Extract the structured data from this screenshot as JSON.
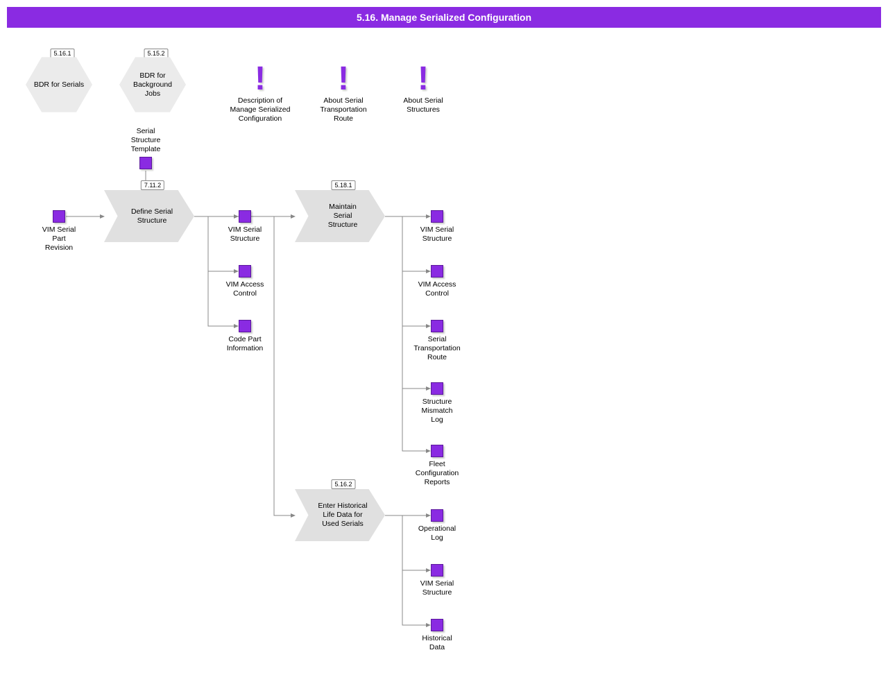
{
  "title": "5.16. Manage Serialized Configuration",
  "hexagons": {
    "bdr_serials": {
      "code": "5.16.1",
      "label": "BDR for Serials"
    },
    "bdr_background": {
      "code": "5.15.2",
      "label": "BDR for\nBackground\nJobs"
    }
  },
  "infos": {
    "desc": "Description of\nManage Serialized\nConfiguration",
    "route": "About Serial\nTransportation\nRoute",
    "structs": "About Serial\nStructures"
  },
  "processes": {
    "define": {
      "code": "7.11.2",
      "label": "Define Serial\nStructure"
    },
    "maintain": {
      "code": "5.18.1",
      "label": "Maintain\nSerial\nStructure"
    },
    "enter": {
      "code": "5.16.2",
      "label": "Enter Historical\nLife Data for\nUsed Serials"
    }
  },
  "data_nodes": {
    "serial_template": "Serial\nStructure\nTemplate",
    "vim_part_rev": "VIM Serial\nPart\nRevision",
    "vim_serial_struct1": "VIM Serial\nStructure",
    "vim_access1": "VIM Access\nControl",
    "code_part": "Code Part\nInformation",
    "vim_serial_struct2": "VIM Serial\nStructure",
    "vim_access2": "VIM Access\nControl",
    "serial_trans_route": "Serial\nTransportation\nRoute",
    "struct_mismatch": "Structure\nMismatch\nLog",
    "fleet_conf": "Fleet\nConfiguration\nReports",
    "op_log": "Operational\nLog",
    "vim_serial_struct3": "VIM Serial\nStructure",
    "hist_data": "Historical\nData"
  }
}
